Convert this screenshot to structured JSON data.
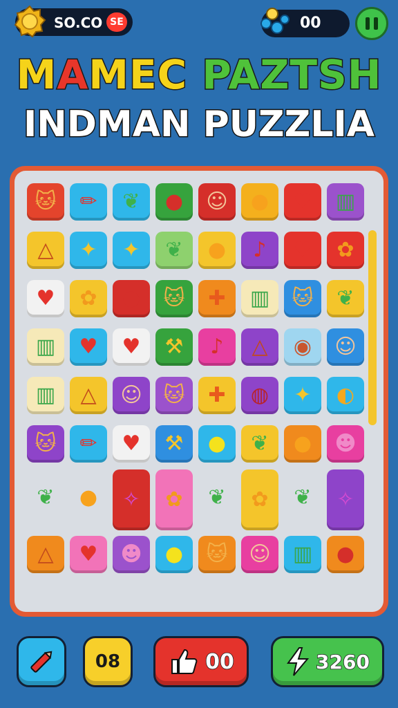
{
  "hud": {
    "coins": "SO.CO",
    "coin_badge": "SE",
    "gems": "00",
    "coin_icon": "gold-coin-icon",
    "gem_icon": "gem-icon",
    "pause_icon": "pause-icon"
  },
  "title": {
    "line1_words": [
      {
        "text": "MAMEC",
        "color": "#f5d31a"
      },
      {
        "text": "PAZTSH",
        "color": "#4fc23a"
      }
    ],
    "line1_mamec_colors": [
      "#f5d31a",
      "#e8362a",
      "#f5d31a",
      "#f5d31a",
      "#f5d31a"
    ],
    "line2": "INDMAN PUZZLIA"
  },
  "board": {
    "rows": [
      [
        [
          "cat",
          "#e4442c"
        ],
        [
          "pencil",
          "#2fb7ea"
        ],
        [
          "leaf",
          "#2fb7ea"
        ],
        [
          "apple",
          "#36a33d"
        ],
        [
          "boy",
          "#d52f2a"
        ],
        [
          "orange",
          "#f4b01d"
        ],
        [
          "heart",
          "#e4332c"
        ],
        [
          "crayons",
          "#9b52cc"
        ]
      ],
      [
        [
          "pyramid",
          "#f4c52b"
        ],
        [
          "bird",
          "#2fb7ea"
        ],
        [
          "bird",
          "#2fb7ea"
        ],
        [
          "leaf",
          "#8ed16e"
        ],
        [
          "orange",
          "#f4c52b"
        ],
        [
          "guitar",
          "#8e44c9"
        ],
        [
          "heart",
          "#e4332c"
        ],
        [
          "maple",
          "#e4332c"
        ]
      ],
      [
        [
          "heart",
          "#f2f2f2"
        ],
        [
          "maple",
          "#f4c52b"
        ],
        [
          "apple",
          "#d52f2a"
        ],
        [
          "cat",
          "#36a33d"
        ],
        [
          "carrot",
          "#f08a1d"
        ],
        [
          "crayons",
          "#f6e9b8"
        ],
        [
          "cat",
          "#2f8fe0"
        ],
        [
          "leaf",
          "#f4c52b"
        ]
      ],
      [
        [
          "crayons",
          "#f6e9b8"
        ],
        [
          "heart",
          "#2fb7ea"
        ],
        [
          "heart",
          "#f2f2f2"
        ],
        [
          "axe",
          "#36a33d"
        ],
        [
          "guitar",
          "#e83fa0"
        ],
        [
          "pyramid",
          "#8e44c9"
        ],
        [
          "owl",
          "#9fd6f0"
        ],
        [
          "boy",
          "#2f8fe0"
        ]
      ],
      [
        [
          "crayons",
          "#f6e9b8"
        ],
        [
          "pyramid",
          "#f4c52b"
        ],
        [
          "boy",
          "#8e44c9"
        ],
        [
          "cat",
          "#9b52cc"
        ],
        [
          "carrot",
          "#f4c52b"
        ],
        [
          "pomegranate",
          "#8e44c9"
        ],
        [
          "bird",
          "#2fb7ea"
        ],
        [
          "ball",
          "#2fb7ea"
        ]
      ],
      [
        [
          "cat",
          "#8e44c9"
        ],
        [
          "pencil",
          "#2fb7ea"
        ],
        [
          "heart",
          "#f2f2f2"
        ],
        [
          "axe",
          "#2f8fe0"
        ],
        [
          "lemon",
          "#2fb7ea"
        ],
        [
          "leaf",
          "#f4c52b"
        ],
        [
          "orange",
          "#f08a1d"
        ],
        [
          "pig",
          "#e83fa0"
        ]
      ],
      [
        [
          "leaf",
          "none"
        ],
        [
          "orange",
          "none"
        ],
        [
          "fish",
          "#d52f2a"
        ],
        [
          "maple",
          "#f273b8"
        ],
        [
          "leaf",
          "none"
        ],
        [
          "maple",
          "#f4c52b"
        ],
        [
          "leaf",
          "none"
        ],
        [
          "fish",
          "#8e44c9"
        ]
      ],
      [
        [
          "pyramid",
          "#f08a1d"
        ],
        [
          "heart",
          "#f273b8"
        ],
        [
          "pig",
          "#9b52cc"
        ],
        [
          "lemon",
          "#2fb7ea"
        ],
        [
          "cat",
          "#f08a1d"
        ],
        [
          "boy",
          "#e83fa0"
        ],
        [
          "crayons",
          "#2fb7ea"
        ],
        [
          "apple",
          "#f08a1d"
        ]
      ]
    ],
    "tall_in_row_7": [
      2,
      3,
      5,
      7
    ]
  },
  "bottom": {
    "b1_icon": "pencil-icon",
    "b2": "08",
    "b3": "00",
    "b3_icon": "thumbs-up-icon",
    "b4": "3260",
    "b4_icon": "lightning-icon"
  }
}
